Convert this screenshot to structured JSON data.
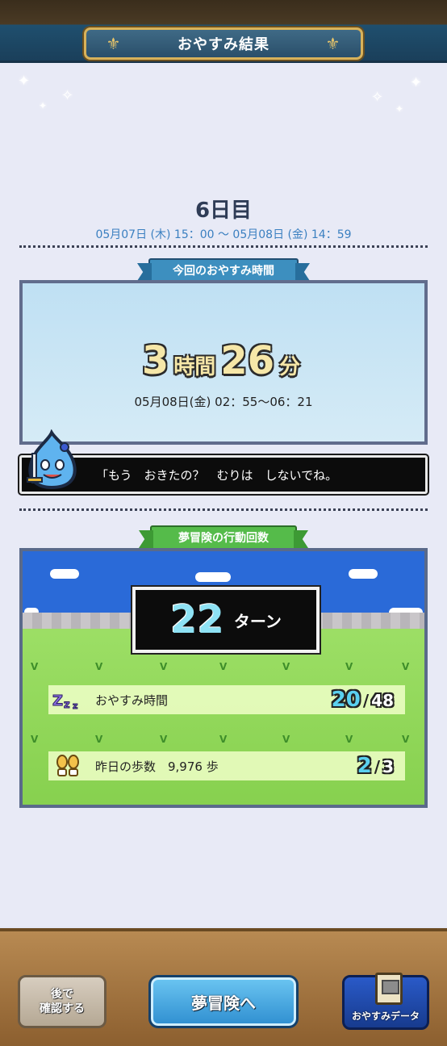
{
  "header": {
    "title": "おやすみ結果"
  },
  "day": {
    "title": "6日目",
    "range": "05月07日 (木) 15：00 ～ 05月08日 (金) 14：59"
  },
  "sleep": {
    "section_label": "今回のおやすみ時間",
    "hours": "3",
    "hours_unit": "時間",
    "minutes": "26",
    "minutes_unit": "分",
    "range": "05月08日(金) 02：55～06：21"
  },
  "message": {
    "text": "「もう　おきたの？　むりは　しないでね。"
  },
  "adventure": {
    "section_label": "夢冒険の行動回数",
    "turns": "22",
    "turns_unit": "ターン",
    "rows": [
      {
        "label": "おやすみ時間",
        "value": "20",
        "sep": "/",
        "max": "48",
        "icon": "zzz-icon"
      },
      {
        "label": "昨日の歩数　9,976 歩",
        "value": "2",
        "sep": "/",
        "max": "3",
        "icon": "footprints-icon"
      }
    ]
  },
  "footer": {
    "later_line1": "後で",
    "later_line2": "確認する",
    "go_label": "夢冒険へ",
    "data_label": "おやすみデータ"
  },
  "colors": {
    "accent_blue": "#3d8fbf",
    "accent_green": "#55bb4a",
    "turn_number": "#8ee2f4"
  }
}
